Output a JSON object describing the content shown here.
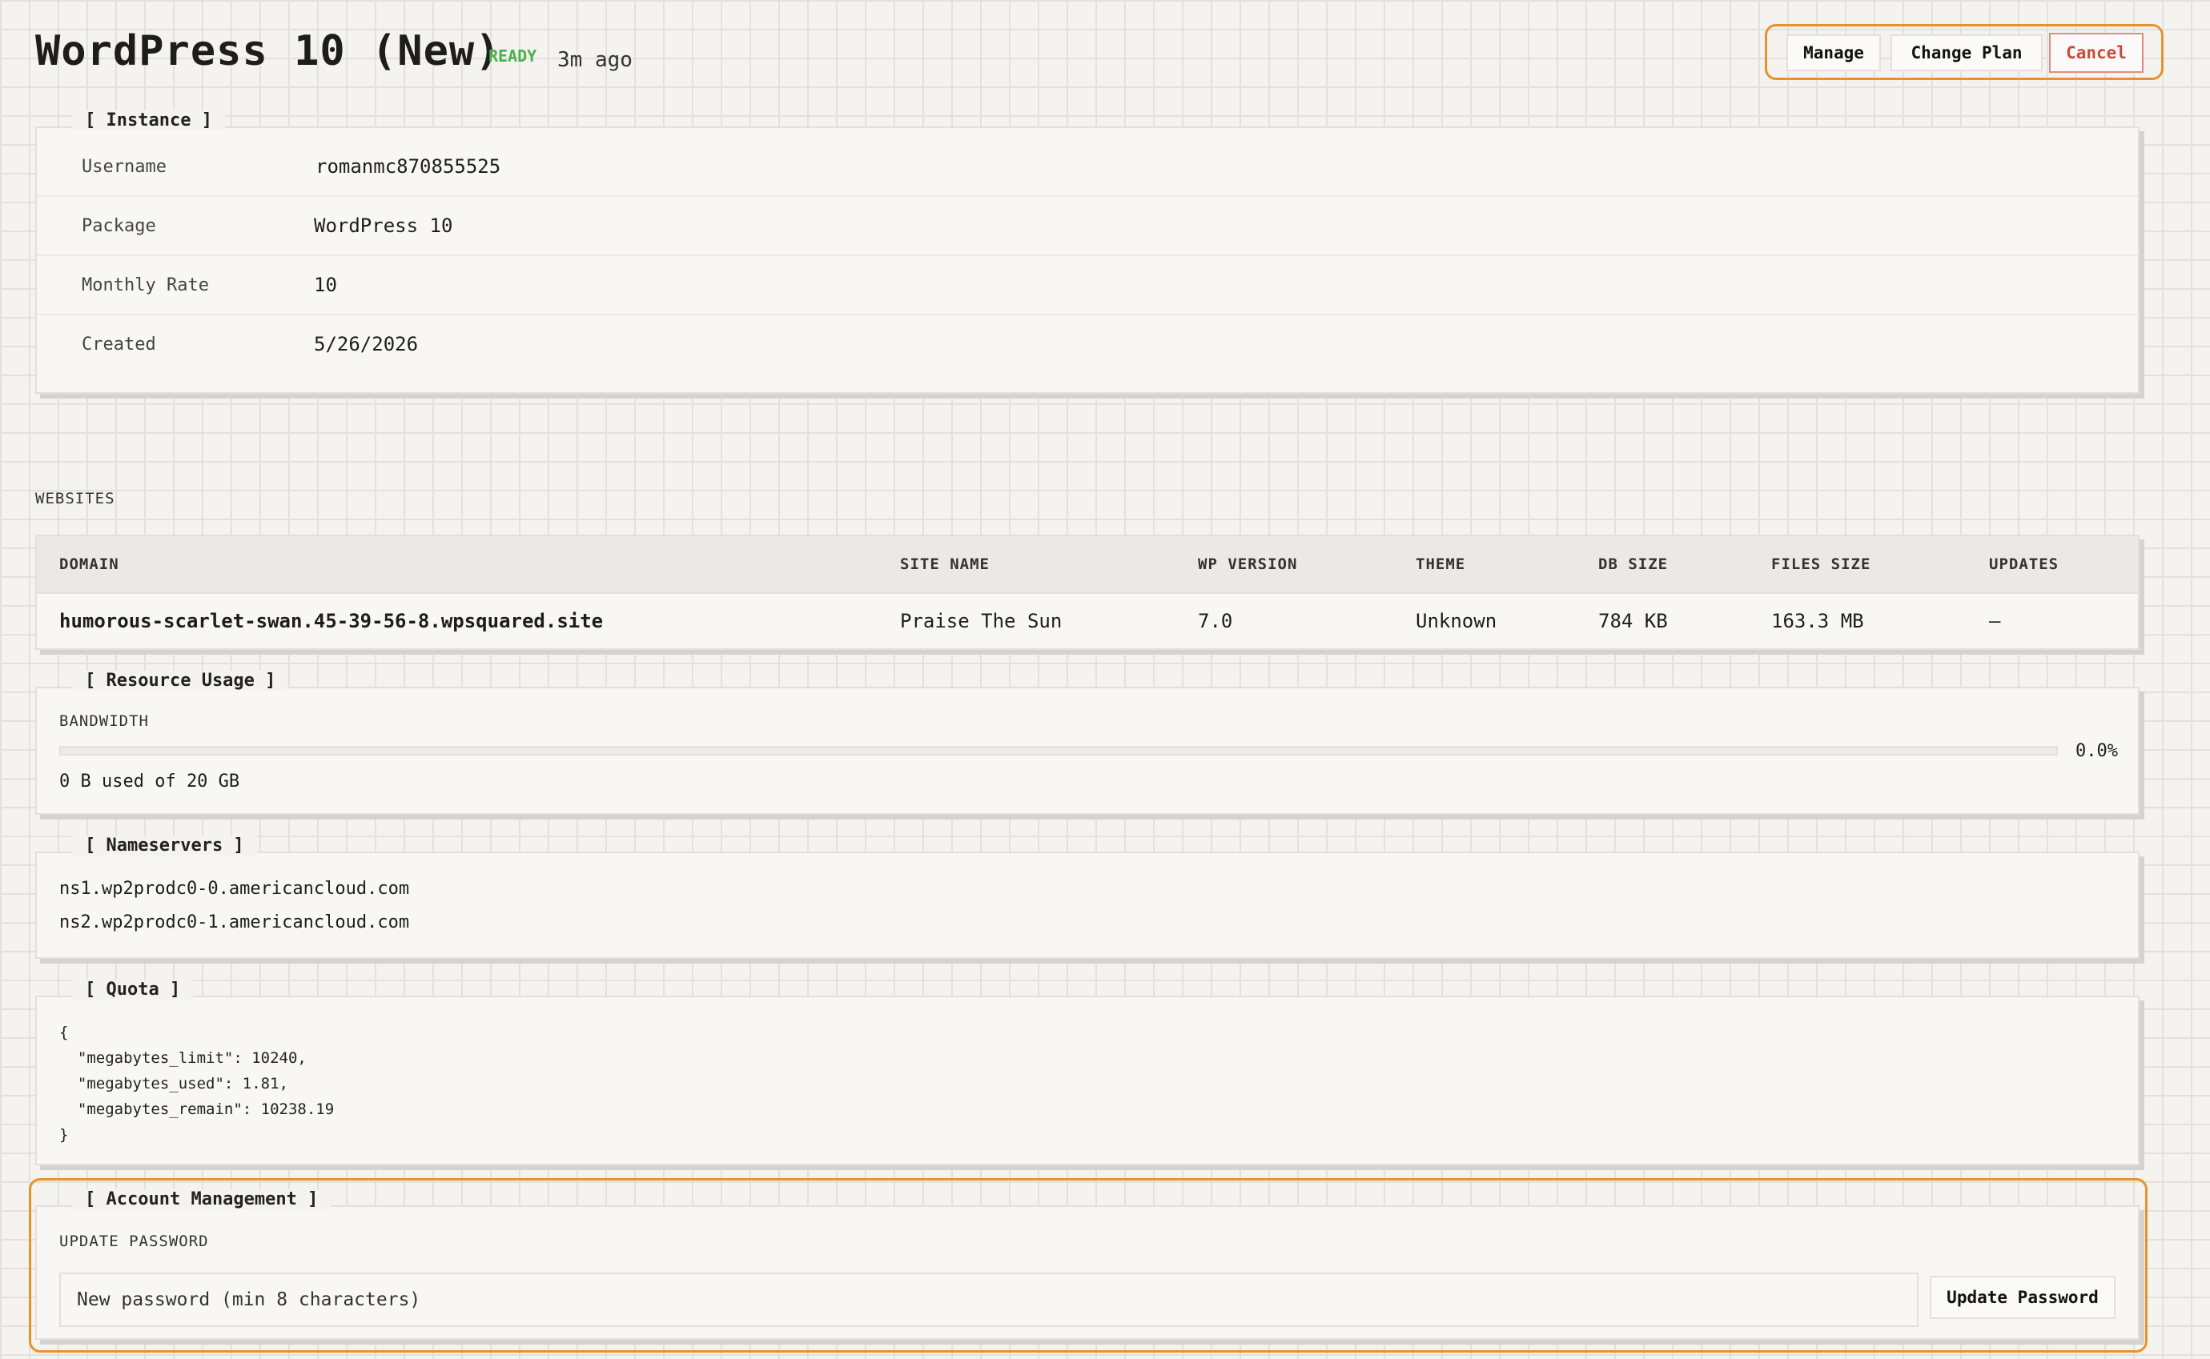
{
  "header": {
    "title": "WordPress 10 (New)",
    "status": "READY",
    "age": "3m ago",
    "buttons": {
      "manage": "Manage",
      "change_plan": "Change Plan",
      "cancel": "Cancel"
    }
  },
  "instance": {
    "legend": "[ Instance ]",
    "rows": [
      {
        "label": "Username",
        "value": "romanmc870855525"
      },
      {
        "label": "Package",
        "value": "WordPress 10"
      },
      {
        "label": "Monthly Rate",
        "value": "10"
      },
      {
        "label": "Created",
        "value": "5/26/2026"
      }
    ]
  },
  "websites": {
    "heading": "WEBSITES",
    "columns": [
      "DOMAIN",
      "SITE NAME",
      "WP VERSION",
      "THEME",
      "DB SIZE",
      "FILES SIZE",
      "UPDATES"
    ],
    "rows": [
      [
        "humorous-scarlet-swan.45-39-56-8.wpsquared.site",
        "Praise The Sun",
        "7.0",
        "Unknown",
        "784 KB",
        "163.3 MB",
        "—"
      ]
    ]
  },
  "resource": {
    "legend": "[ Resource Usage ]",
    "bandwidth_label": "BANDWIDTH",
    "percent_text": "0.0%",
    "percent_value": 0.0,
    "used_text": "0 B used of 20 GB"
  },
  "nameservers": {
    "legend": "[ Nameservers ]",
    "items": [
      "ns1.wp2prodc0-0.americancloud.com",
      "ns2.wp2prodc0-1.americancloud.com"
    ]
  },
  "quota": {
    "legend": "[ Quota ]",
    "json_text": "{\n  \"megabytes_limit\": 10240,\n  \"megabytes_used\": 1.81,\n  \"megabytes_remain\": 10238.19\n}"
  },
  "account": {
    "legend": "[ Account Management ]",
    "section_label": "UPDATE PASSWORD",
    "input_placeholder": "New password (min 8 characters)",
    "button_label": "Update Password"
  },
  "colors": {
    "accent": "#e8922e",
    "ready": "#4caf50",
    "cancel": "#c94a3c"
  }
}
